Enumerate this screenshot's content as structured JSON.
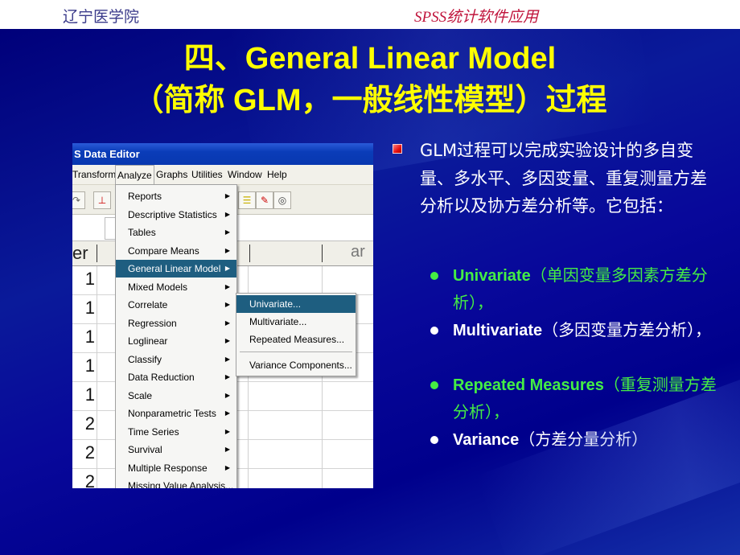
{
  "header": {
    "left": "辽宁医学院",
    "right": "SPSS统计软件应用"
  },
  "title": {
    "line1": "四、General Linear Model",
    "line2": "（简称 GLM，一般线性模型）过程"
  },
  "spss": {
    "window_title": "S Data Editor",
    "menubar": [
      "Transform",
      "Analyze",
      "Graphs",
      "Utilities",
      "Window",
      "Help"
    ],
    "menubar_active": "Analyze",
    "grid_header_left": "er",
    "grid_header_right": "ar",
    "row_numbers": [
      "1",
      "1",
      "1",
      "1",
      "1",
      "2",
      "2",
      "2"
    ],
    "analyze_menu": [
      "Reports",
      "Descriptive Statistics",
      "Tables",
      "Compare Means",
      "General Linear Model",
      "Mixed Models",
      "Correlate",
      "Regression",
      "Loglinear",
      "Classify",
      "Data Reduction",
      "Scale",
      "Nonparametric Tests",
      "Time Series",
      "Survival",
      "Multiple Response",
      "Missing Value Analysis..."
    ],
    "analyze_selected": "General Linear Model",
    "glm_submenu": [
      "Univariate...",
      "Multivariate...",
      "Repeated Measures...",
      "Variance Components..."
    ],
    "glm_selected": "Univariate..."
  },
  "content": {
    "intro": "GLM过程可以完成实验设计的多自变量、多水平、多因变量、重复测量方差分析以及协方差分析等。它包括：",
    "items": [
      {
        "en": "Univariate",
        "cn": "（单因变量多因素方差分析），",
        "color": "green"
      },
      {
        "en": "Multivariate",
        "cn": "（多因变量方差分析），",
        "color": "white"
      },
      {
        "en": "Repeated Measures",
        "cn": "（重复测量方差分析），",
        "color": "green"
      },
      {
        "en": "Variance",
        "cn": "（方差分量分析）",
        "color": "white"
      }
    ]
  },
  "colors": {
    "title": "#ffff00",
    "accent_green": "#44ee44",
    "bullet_red": "#e81010",
    "background": "#00008c",
    "menu_highlight": "#1e5e80"
  }
}
